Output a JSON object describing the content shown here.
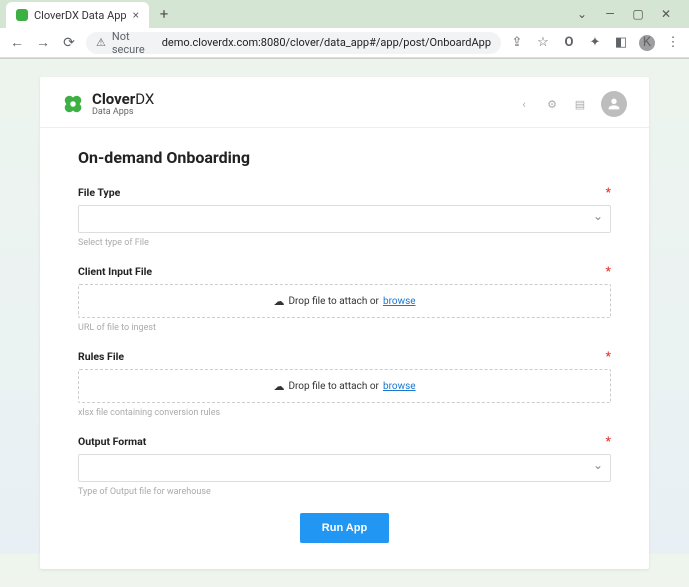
{
  "browser": {
    "tab_title": "CloverDX Data App",
    "security_label": "Not secure",
    "url": "demo.cloverdx.com:8080/clover/data_app#/app/post/OnboardApp",
    "avatar_letter": "K"
  },
  "app": {
    "brand_main": "Clover",
    "brand_suffix": "DX",
    "brand_sub": "Data Apps"
  },
  "form": {
    "title": "On-demand Onboarding",
    "required_mark": "*",
    "file_type": {
      "label": "File Type",
      "helper": "Select type of File"
    },
    "client_input": {
      "label": "Client Input File",
      "drop_text_prefix": "Drop file to attach or ",
      "drop_browse": "browse",
      "helper": "URL of file to ingest"
    },
    "rules_file": {
      "label": "Rules File",
      "drop_text_prefix": "Drop file to attach or ",
      "drop_browse": "browse",
      "helper": "xlsx file containing conversion rules"
    },
    "output_format": {
      "label": "Output Format",
      "helper": "Type of Output file for warehouse"
    },
    "run_button": "Run App"
  }
}
